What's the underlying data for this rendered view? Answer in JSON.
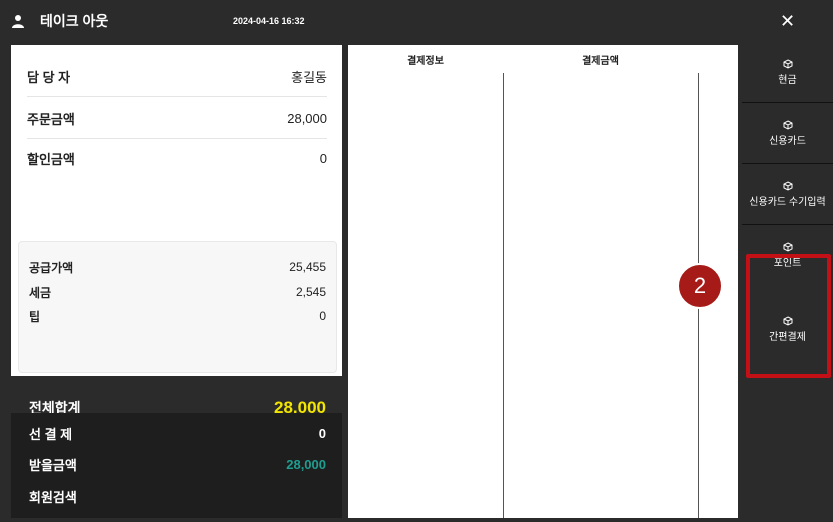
{
  "header": {
    "title": "테이크 아웃",
    "datetime": "2024-04-16 16:32",
    "close_label": "✕"
  },
  "summary": {
    "manager": {
      "label": "담 당 자",
      "value": "홍길동"
    },
    "order_amount": {
      "label": "주문금액",
      "value": "28,000"
    },
    "discount_amount": {
      "label": "할인금액",
      "value": "0"
    }
  },
  "tax_box": {
    "supply": {
      "label": "공급가액",
      "value": "25,455"
    },
    "tax": {
      "label": "세금",
      "value": "2,545"
    },
    "tip": {
      "label": "팁",
      "value": "0"
    }
  },
  "total": {
    "label": "전체합계",
    "value": "28,000"
  },
  "bottom": {
    "prepay": {
      "label": "선 결 제",
      "value": "0"
    },
    "received": {
      "label": "받을금액",
      "value": "28,000"
    },
    "member_search": {
      "label": "회원검색"
    }
  },
  "payment_table": {
    "headers": [
      "결제정보",
      "결제금액"
    ]
  },
  "sidebar": {
    "items": [
      {
        "label": "현금"
      },
      {
        "label": "신용카드"
      },
      {
        "label": "신용카드 수기입력"
      },
      {
        "label": "포인트"
      },
      {
        "label": "간편결제"
      }
    ]
  },
  "badge": {
    "number": "2"
  },
  "colors": {
    "dark_bg": "#2b2b2b",
    "total_yellow": "#f2e600",
    "teal": "#1e9e91",
    "highlight_red": "#c30f16"
  }
}
